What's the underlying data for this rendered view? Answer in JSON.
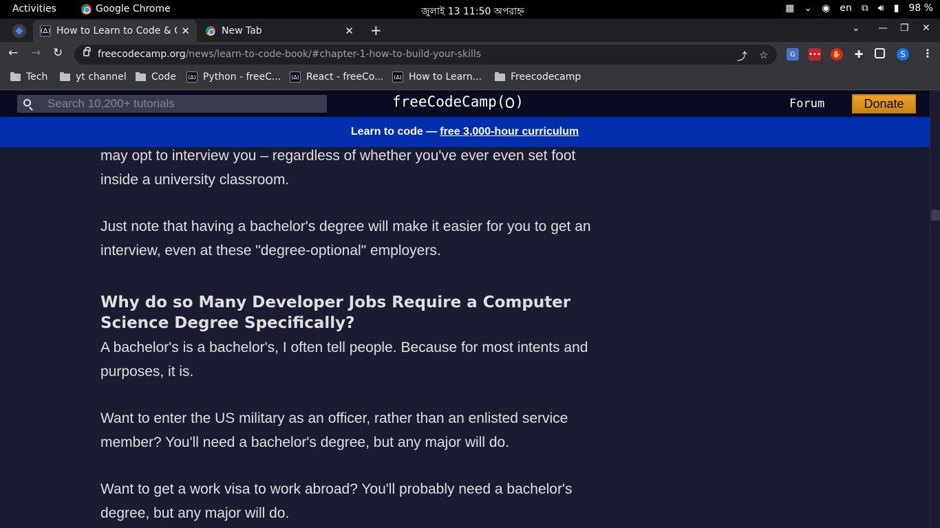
{
  "os_topbar": {
    "activities": "Activities",
    "app_name": "Google Chrome",
    "clock": "জুলাই 13  11:50 অপরাহ্ন",
    "keyboard_lang": "en",
    "battery": "98 %"
  },
  "tabs": [
    {
      "title": "How to Learn to Code & G",
      "active": true
    },
    {
      "title": "New Tab",
      "active": false
    }
  ],
  "address_bar": {
    "host": "freecodecamp.org",
    "path": "/news/learn-to-code-book/#chapter-1-how-to-build-your-skills"
  },
  "profile_initial": "S",
  "bookmarks": [
    {
      "label": "Tech",
      "icon": "folder-icon"
    },
    {
      "label": "yt channel",
      "icon": "folder-icon"
    },
    {
      "label": "Code",
      "icon": "folder-icon"
    },
    {
      "label": "Python - freeC...",
      "icon": "freecodecamp-icon"
    },
    {
      "label": "React - freeCo...",
      "icon": "freecodecamp-icon"
    },
    {
      "label": "How to Learn...",
      "icon": "freecodecamp-icon"
    },
    {
      "label": "Freecodecamp",
      "icon": "folder-icon"
    }
  ],
  "site_nav": {
    "search_placeholder": "Search 10,200+ tutorials",
    "logo_text_left": "freeCodeCamp(",
    "logo_text_right": ")",
    "forum": "Forum",
    "donate": "Donate"
  },
  "banner": {
    "prefix": "Learn to code —",
    "link": "free 3,000-hour curriculum"
  },
  "article": {
    "p1": "may opt to interview you – regardless of whether you've ever even set foot inside a university classroom.",
    "p2": "Just note that having a bachelor's degree will make it easier for you to get an interview, even at these \"degree-optional\" employers.",
    "h2": "Why do so Many Developer Jobs Require a Computer Science Degree Specifically?",
    "p3": "A bachelor's is a bachelor's, I often tell people. Because for most intents and purposes, it is.",
    "p4": "Want to enter the US military as an officer, rather than an enlisted service member? You'll need a bachelor's degree, but any major will do.",
    "p5": "Want to get a work visa to work abroad? You'll probably need a bachelor's degree, but any major will do."
  },
  "colors": {
    "page_bg": "#1b1b32",
    "nav_bg": "#0a0a23",
    "banner_bg": "#002ead",
    "donate_bg": "#feac32",
    "text": "#dfdfe2"
  }
}
